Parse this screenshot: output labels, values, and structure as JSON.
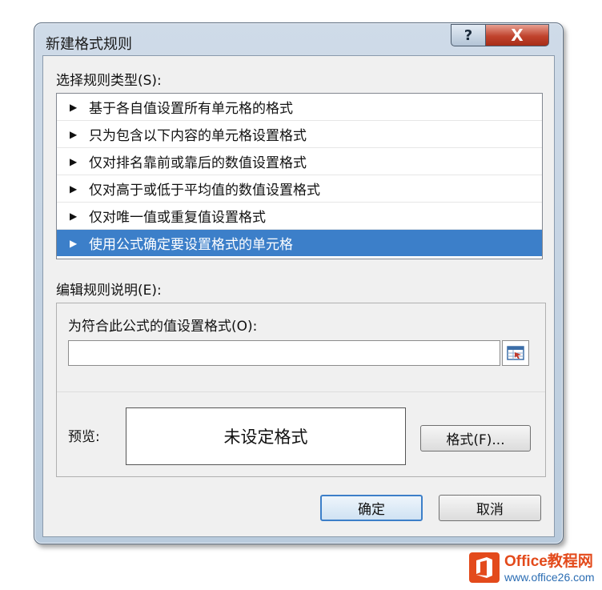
{
  "window": {
    "title": "新建格式规则",
    "help_label": "?",
    "close_label": "X"
  },
  "rule_type": {
    "label": "选择规则类型(S):",
    "items": [
      {
        "label": "基于各自值设置所有单元格的格式"
      },
      {
        "label": "只为包含以下内容的单元格设置格式"
      },
      {
        "label": "仅对排名靠前或靠后的数值设置格式"
      },
      {
        "label": "仅对高于或低于平均值的数值设置格式"
      },
      {
        "label": "仅对唯一值或重复值设置格式"
      },
      {
        "label": "使用公式确定要设置格式的单元格",
        "selected": true
      }
    ]
  },
  "description": {
    "label": "编辑规则说明(E):",
    "formula_label": "为符合此公式的值设置格式(O):",
    "formula_value": "",
    "preview_label": "预览:",
    "preview_text": "未设定格式",
    "format_button": "格式(F)..."
  },
  "buttons": {
    "ok": "确定",
    "cancel": "取消"
  },
  "watermark": {
    "name": "Office教程网",
    "url": "www.office26.com"
  },
  "colors": {
    "selection": "#3c7fc9",
    "close_button": "#c0432d",
    "watermark": "#e34a1b"
  }
}
